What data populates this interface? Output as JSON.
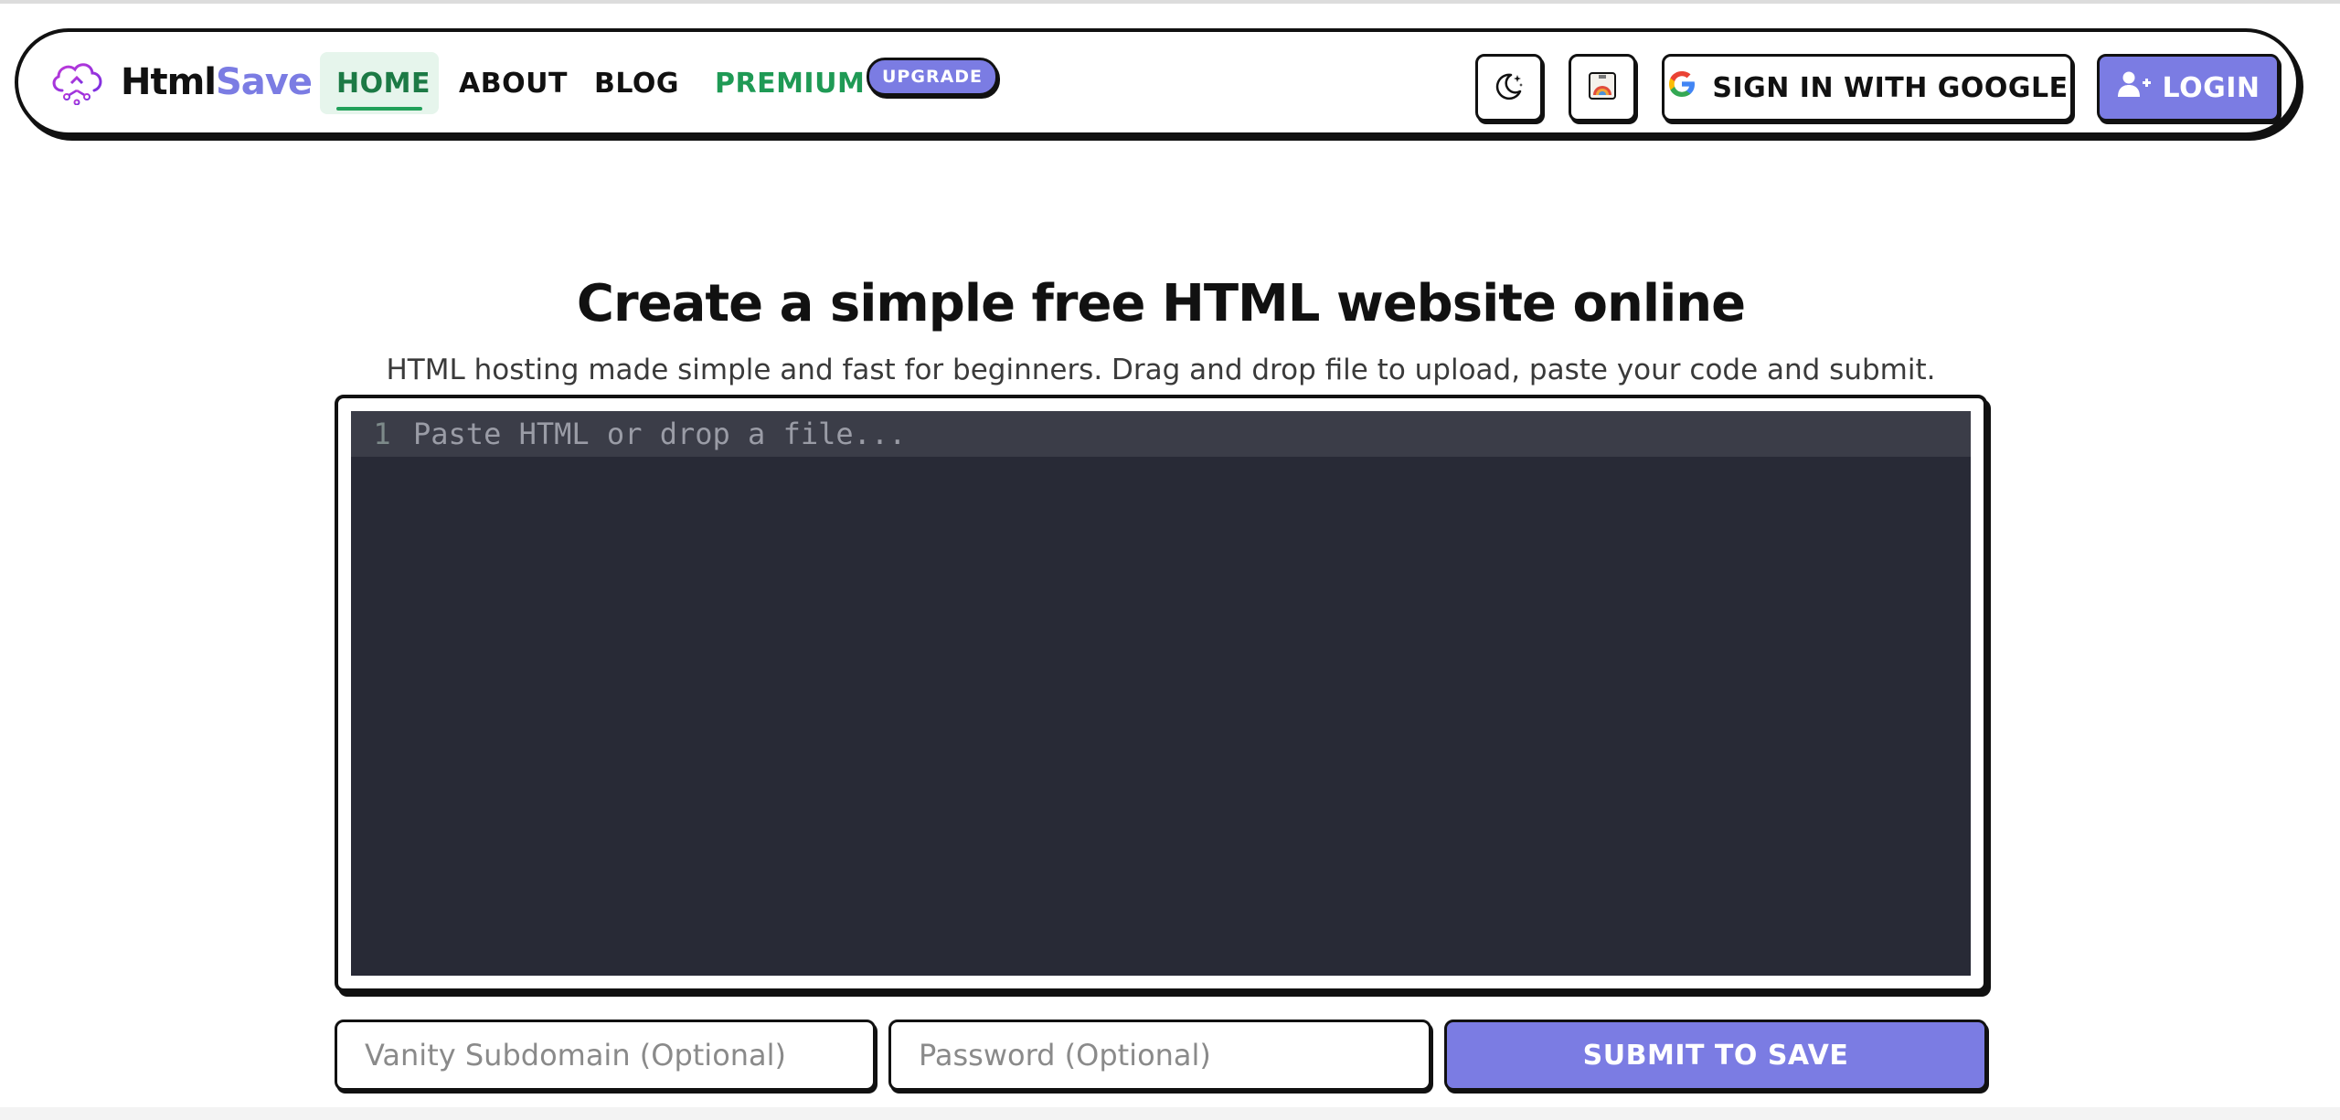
{
  "brand": {
    "name_part1": "Html",
    "name_part2": "Save",
    "accent_color": "#7b7ce3",
    "logo_icon": "cloud-upload-icon"
  },
  "nav": {
    "home": "HOME",
    "about": "ABOUT",
    "blog": "BLOG",
    "premium": "PREMIUM",
    "upgrade_badge": "UPGRADE",
    "active": "HOME",
    "active_color": "#22a05a"
  },
  "header_actions": {
    "theme_icon": "moon-stars-icon",
    "palette_icon": "palette-icon",
    "google_signin": "SIGN IN WITH GOOGLE",
    "login": "LOGIN"
  },
  "hero": {
    "title": "Create a simple free HTML website online",
    "subtitle": "HTML hosting made simple and fast for beginners. Drag and drop file to upload, paste your code and submit."
  },
  "editor": {
    "line_number": "1",
    "placeholder": "Paste HTML or drop a file...",
    "background": "#282a36"
  },
  "form": {
    "subdomain_placeholder": "Vanity Subdomain (Optional)",
    "password_placeholder": "Password (Optional)",
    "submit": "SUBMIT TO SAVE"
  }
}
